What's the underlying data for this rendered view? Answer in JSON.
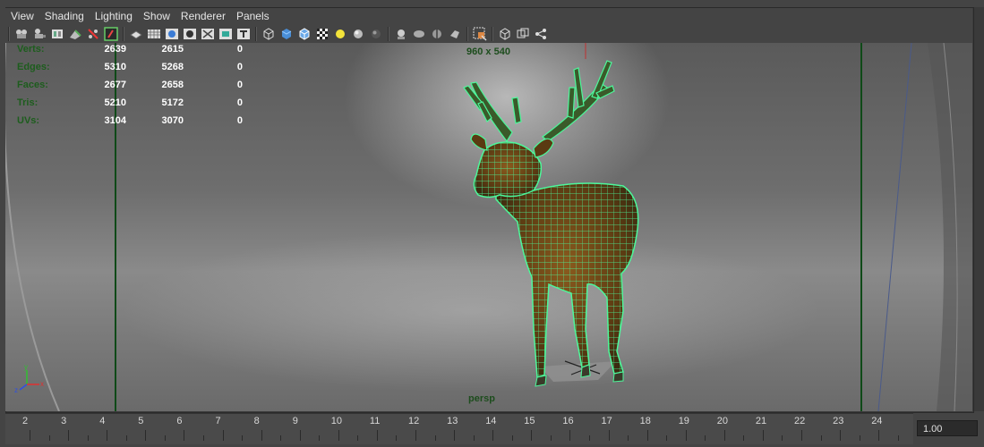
{
  "menubar": {
    "items": [
      "View",
      "Shading",
      "Lighting",
      "Show",
      "Renderer",
      "Panels"
    ]
  },
  "toolbar": {
    "buttons": [
      "camera-attributes-icon",
      "bookmark-icon",
      "image-plane-icon",
      "two-d-pan-zoom-icon",
      "grease-pencil-icon",
      "frame-all-icon",
      "grid-icon",
      "film-gate-icon",
      "resolution-gate-icon",
      "gate-mask-icon",
      "field-chart-icon",
      "safe-action-icon",
      "safe-title-icon",
      "wireframe-icon",
      "smooth-shade-icon",
      "wireframe-on-shaded-icon",
      "textured-icon",
      "use-default-lights-icon",
      "shadows-icon",
      "screen-space-ao-icon",
      "motion-blur-icon",
      "multisample-aa-icon",
      "depth-of-field-icon",
      "x-ray-icon",
      "isolate-select-icon",
      "xray-joints-icon",
      "backface-culling-icon",
      "hud-icon"
    ]
  },
  "hud": {
    "rows": [
      {
        "label": "Verts:",
        "v1": "2639",
        "v2": "2615",
        "v3": "0"
      },
      {
        "label": "Edges:",
        "v1": "5310",
        "v2": "5268",
        "v3": "0"
      },
      {
        "label": "Faces:",
        "v1": "2677",
        "v2": "2658",
        "v3": "0"
      },
      {
        "label": "Tris:",
        "v1": "5210",
        "v2": "5172",
        "v3": "0"
      },
      {
        "label": "UVs:",
        "v1": "3104",
        "v2": "3070",
        "v3": "0"
      }
    ]
  },
  "viewport": {
    "resolution": "960 x 540",
    "camera": "persp",
    "axis": {
      "x": "x",
      "y": "y",
      "z": "z"
    }
  },
  "timeline": {
    "labels": [
      "2",
      "3",
      "4",
      "5",
      "6",
      "7",
      "8",
      "9",
      "10",
      "11",
      "12",
      "13",
      "14",
      "15",
      "16",
      "17",
      "18",
      "19",
      "20",
      "21",
      "22",
      "23",
      "24"
    ],
    "current_time": "1.00"
  },
  "colors": {
    "hud_label": "#1d5d1d",
    "wireframe": "#3dff8a",
    "axis_x": "#e03030",
    "axis_y": "#30c030",
    "axis_z": "#3050e0"
  }
}
